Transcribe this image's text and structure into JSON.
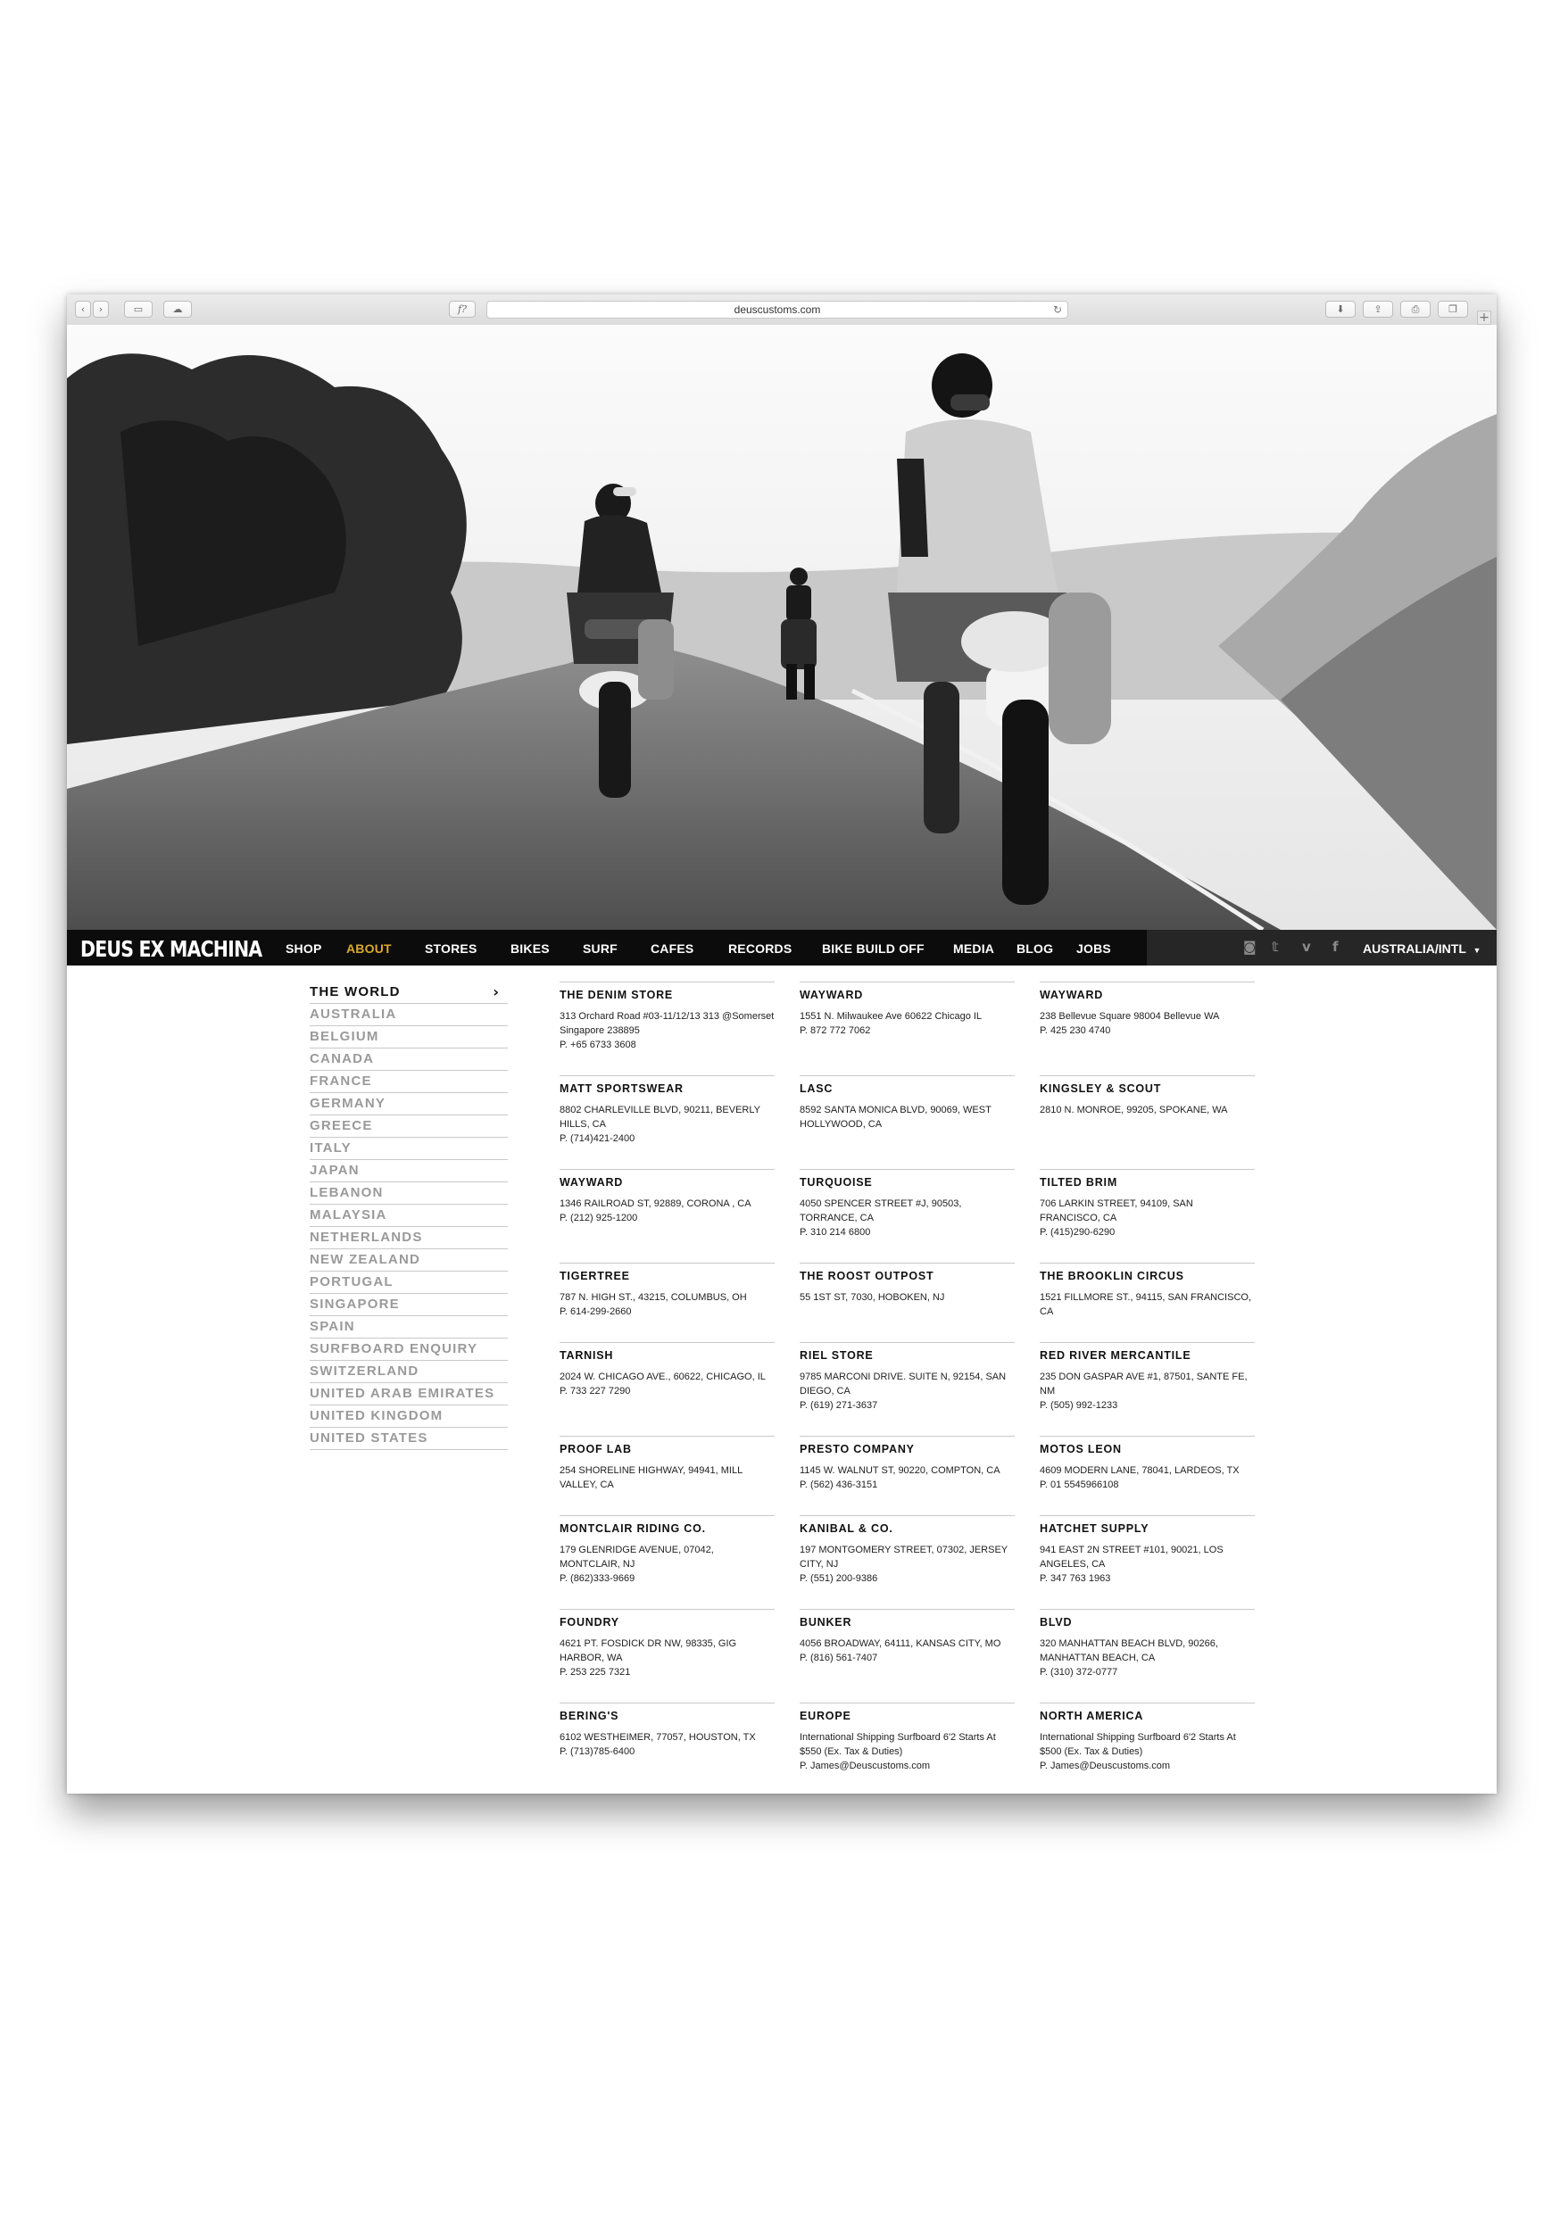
{
  "browser": {
    "url": "deuscustoms.com",
    "reader_label": "f?",
    "icons": [
      "back-icon",
      "forward-icon",
      "sidebar-icon",
      "cloud-icon",
      "reload-icon",
      "download-icon",
      "share-icon",
      "print-icon",
      "tabs-icon",
      "new-tab-icon"
    ]
  },
  "nav": {
    "logo": "DEUS EX MACHINA",
    "items": [
      "SHOP",
      "ABOUT",
      "STORES",
      "BIKES",
      "SURF",
      "CAFES",
      "RECORDS",
      "BIKE BUILD OFF",
      "MEDIA",
      "BLOG",
      "JOBS"
    ],
    "active": "ABOUT",
    "active_color": "#d8aa2c",
    "social": [
      "instagram-icon",
      "twitter-icon",
      "vimeo-icon",
      "facebook-icon"
    ],
    "region": "AUSTRALIA/INTL"
  },
  "sidebar": {
    "heading": "THE WORLD",
    "items": [
      "AUSTRALIA",
      "BELGIUM",
      "CANADA",
      "FRANCE",
      "GERMANY",
      "GREECE",
      "ITALY",
      "JAPAN",
      "LEBANON",
      "MALAYSIA",
      "NETHERLANDS",
      "NEW ZEALAND",
      "PORTUGAL",
      "SINGAPORE",
      "SPAIN",
      "SURFBOARD ENQUIRY",
      "SWITZERLAND",
      "UNITED ARAB EMIRATES",
      "UNITED KINGDOM",
      "UNITED STATES"
    ]
  },
  "stores": [
    {
      "name": "THE DENIM STORE",
      "address": "313 Orchard Road #03-11/12/13 313 @Somerset Singapore 238895",
      "phone": "P. +65 6733 3608"
    },
    {
      "name": "WAYWARD",
      "address": "1551 N. Milwaukee Ave 60622 Chicago IL",
      "phone": "P. 872 772 7062"
    },
    {
      "name": "WAYWARD",
      "address": "238 Bellevue Square 98004 Bellevue WA",
      "phone": "P. 425 230 4740"
    },
    {
      "name": "MATT SPORTSWEAR",
      "address": "8802 CHARLEVILLE BLVD, 90211, BEVERLY HILLS, CA",
      "phone": "P. (714)421-2400"
    },
    {
      "name": "LASC",
      "address": "8592 SANTA MONICA BLVD, 90069, WEST HOLLYWOOD, CA",
      "phone": ""
    },
    {
      "name": "KINGSLEY & SCOUT",
      "address": "2810 N. MONROE, 99205, SPOKANE, WA",
      "phone": ""
    },
    {
      "name": "WAYWARD",
      "address": "1346 RAILROAD ST, 92889, CORONA , CA",
      "phone": "P. (212) 925-1200"
    },
    {
      "name": "TURQUOISE",
      "address": "4050 SPENCER STREET #J, 90503, TORRANCE, CA",
      "phone": "P. 310 214 6800"
    },
    {
      "name": "TILTED BRIM",
      "address": "706 LARKIN STREET, 94109, SAN FRANCISCO, CA",
      "phone": "P. (415)290-6290"
    },
    {
      "name": "TIGERTREE",
      "address": "787 N. HIGH ST., 43215, COLUMBUS, OH",
      "phone": "P. 614-299-2660"
    },
    {
      "name": "THE ROOST OUTPOST",
      "address": "55 1ST ST, 7030, HOBOKEN, NJ",
      "phone": ""
    },
    {
      "name": "THE BROOKLIN CIRCUS",
      "address": "1521 FILLMORE ST., 94115, SAN FRANCISCO, CA",
      "phone": ""
    },
    {
      "name": "TARNISH",
      "address": "2024 W. CHICAGO AVE., 60622, CHICAGO, IL",
      "phone": "P. 733 227 7290"
    },
    {
      "name": "RIEL STORE",
      "address": "9785 MARCONI DRIVE. SUITE N, 92154, SAN DIEGO, CA",
      "phone": "P. (619) 271-3637"
    },
    {
      "name": "RED RIVER MERCANTILE",
      "address": "235 DON GASPAR AVE #1, 87501, SANTE FE, NM",
      "phone": "P. (505) 992-1233"
    },
    {
      "name": "PROOF LAB",
      "address": "254 SHORELINE HIGHWAY, 94941, MILL VALLEY, CA",
      "phone": ""
    },
    {
      "name": "PRESTO COMPANY",
      "address": "1145 W. WALNUT ST, 90220, COMPTON, CA",
      "phone": "P. (562) 436-3151"
    },
    {
      "name": "MOTOS LEON",
      "address": "4609 MODERN LANE, 78041, LARDEOS, TX",
      "phone": "P. 01 5545966108"
    },
    {
      "name": "MONTCLAIR RIDING CO.",
      "address": "179 GLENRIDGE AVENUE, 07042, MONTCLAIR, NJ",
      "phone": "P. (862)333-9669"
    },
    {
      "name": "KANIBAL & CO.",
      "address": "197 MONTGOMERY STREET, 07302, JERSEY CITY, NJ",
      "phone": "P. (551) 200-9386"
    },
    {
      "name": "HATCHET SUPPLY",
      "address": "941 EAST 2N STREET #101, 90021, LOS ANGELES, CA",
      "phone": "P. 347 763 1963"
    },
    {
      "name": "FOUNDRY",
      "address": "4621 PT. FOSDICK DR NW, 98335, GIG HARBOR, WA",
      "phone": "P. 253 225 7321"
    },
    {
      "name": "BUNKER",
      "address": "4056 BROADWAY, 64111, KANSAS CITY, MO",
      "phone": "P. (816) 561-7407"
    },
    {
      "name": "BLVD",
      "address": "320 MANHATTAN BEACH BLVD, 90266, MANHATTAN BEACH, CA",
      "phone": "P. (310) 372-0777"
    },
    {
      "name": "BERING'S",
      "address": "6102 WESTHEIMER, 77057, HOUSTON, TX",
      "phone": "P. (713)785-6400"
    },
    {
      "name": "EUROPE",
      "address": "International Shipping Surfboard 6'2 Starts At $550 (Ex. Tax & Duties)",
      "phone": "P. James@Deuscustoms.com"
    },
    {
      "name": "NORTH AMERICA",
      "address": "International Shipping Surfboard 6'2 Starts At $500 (Ex. Tax & Duties)",
      "phone": "P. James@Deuscustoms.com"
    }
  ]
}
